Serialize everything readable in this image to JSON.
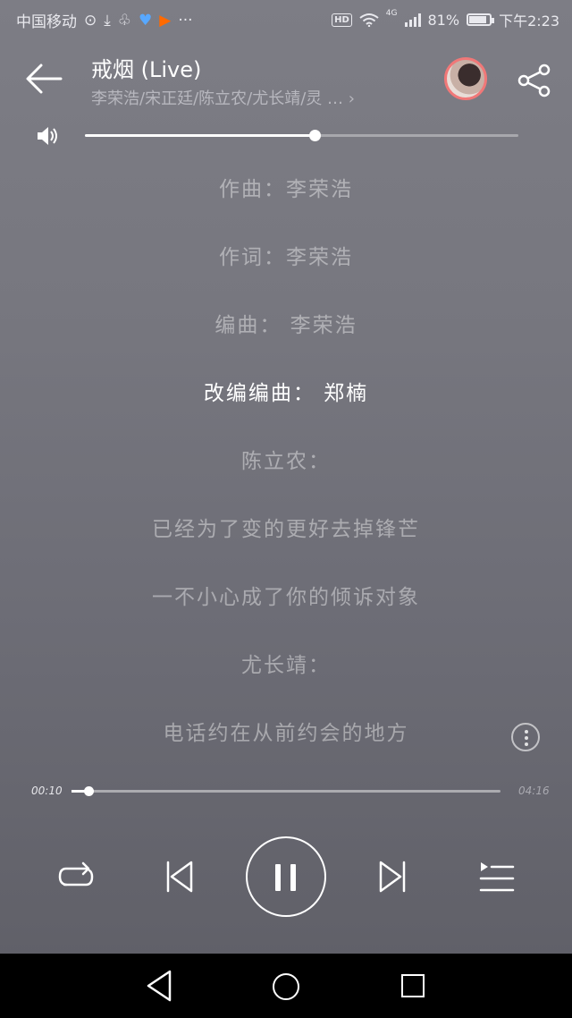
{
  "status_bar": {
    "carrier": "中国移动",
    "network": "4G",
    "battery": "81%",
    "time": "下午2:23",
    "hd": "HD",
    "more": "···"
  },
  "header": {
    "title": "戒烟 (Live)",
    "artists": "李荣浩/宋正廷/陈立农/尤长靖/灵 …  ›"
  },
  "volume": {
    "level": 0.53
  },
  "lyrics": [
    {
      "text": "作曲：李荣浩",
      "active": false
    },
    {
      "text": "作词：李荣浩",
      "active": false
    },
    {
      "text": "编曲： 李荣浩",
      "active": false
    },
    {
      "text": "改编编曲： 郑楠",
      "active": true
    },
    {
      "text": "陈立农：",
      "active": false
    },
    {
      "text": "已经为了变的更好去掉锋芒",
      "active": false
    },
    {
      "text": "一不小心成了你的倾诉对象",
      "active": false
    },
    {
      "text": "尤长靖：",
      "active": false
    },
    {
      "text": "电话约在从前约会的地方",
      "active": false
    }
  ],
  "progress": {
    "current": "00:10",
    "total": "04:16",
    "fraction": 0.04
  },
  "colors": {
    "accent": "#ffffff",
    "avatar_ring": "#f07878",
    "navbar": "#000000"
  }
}
